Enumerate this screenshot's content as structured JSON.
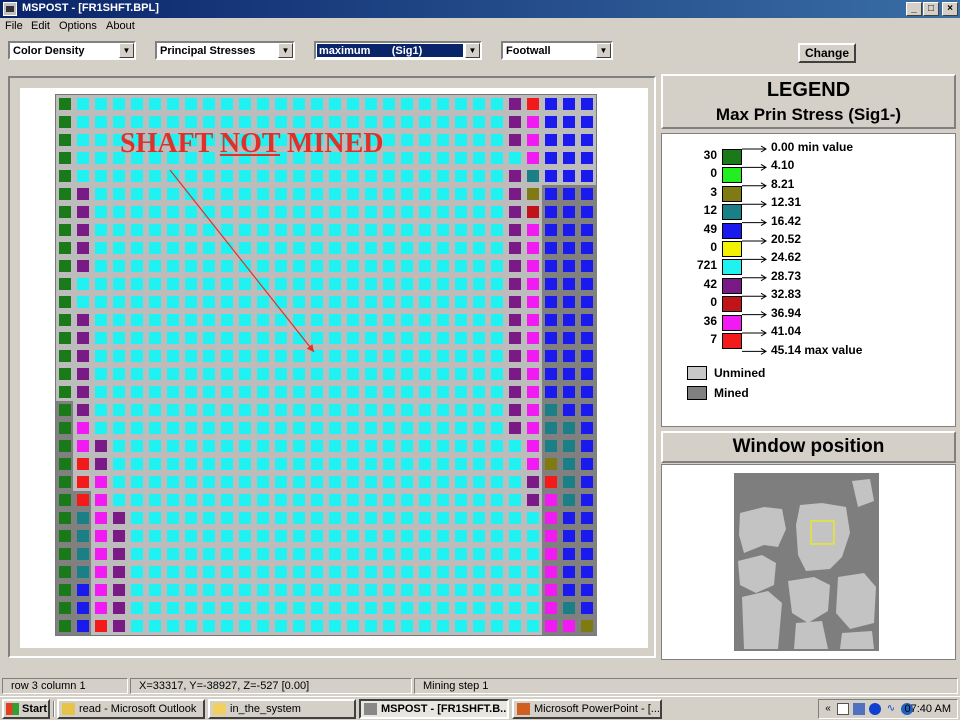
{
  "window": {
    "title": "MSPOST - [FR1SHFT.BPL]"
  },
  "menu": [
    "File",
    "Edit",
    "Options",
    "About"
  ],
  "toolbar": {
    "combos": [
      "Color Density",
      "Principal Stresses",
      "maximum       (Sig1)",
      "Footwall"
    ],
    "change_label": "Change"
  },
  "annotation": {
    "pre": "SHAFT ",
    "underlined": "NOT",
    "post": " MINED"
  },
  "legend": {
    "title": "LEGEND",
    "subtitle": "Max Prin Stress (Sig1-)",
    "rows": [
      {
        "count": "30",
        "color": "#1a7a1a",
        "value": "0.00 min value"
      },
      {
        "count": "0",
        "color": "#22ee22",
        "value": "4.10"
      },
      {
        "count": "3",
        "color": "#7f7a12",
        "value": "8.21"
      },
      {
        "count": "12",
        "color": "#1a7f86",
        "value": "12.31"
      },
      {
        "count": "49",
        "color": "#1a1aee",
        "value": "16.42"
      },
      {
        "count": "0",
        "color": "#f2f200",
        "value": "20.52"
      },
      {
        "count": "721",
        "color": "#20f2f2",
        "value": "24.62"
      },
      {
        "count": "42",
        "color": "#7a1a86",
        "value": "28.73"
      },
      {
        "count": "0",
        "color": "#c0141a",
        "value": "32.83"
      },
      {
        "count": "36",
        "color": "#f21af2",
        "value": "36.94"
      },
      {
        "count": "7",
        "color": "#f21a1a",
        "value": "41.04"
      }
    ],
    "max_label": "45.14 max value",
    "keys": [
      {
        "label": "Unmined",
        "color": "#c8c8c8"
      },
      {
        "label": "Mined",
        "color": "#808080"
      }
    ]
  },
  "window_position": {
    "title": "Window position"
  },
  "status": [
    "row 3    column 1",
    "X=33317, Y=-38927, Z=-527   [0.00]",
    "Mining step 1"
  ],
  "taskbar": {
    "start": "Start",
    "tasks": [
      "read - Microsoft Outlook",
      "in_the_system",
      "MSPOST - [FR1SHFT.B...",
      "Microsoft PowerPoint - [..."
    ],
    "clock": "07:40 AM"
  },
  "grid_colors": {
    "G": "#1a7a1a",
    "O": "#7f7a12",
    "T": "#1a7f86",
    "B": "#1a1aee",
    "C": "#20f2f2",
    "P": "#7a1a86",
    "R": "#f21a1a",
    "M": "#f21af2",
    "D": "#c0141a"
  },
  "grid_rows": [
    "GCCCCCCCCCCCCCCCCCCCCCCCCPRBBB",
    "GCCCCCCCCCCCCCCCCCCCCCCCCPMBBB",
    "GCCCCCCCCCCCCCCCCCCCCCCCCPMBBB",
    "GCCCCCCCCCCCCCCCCCCCCCCCCCMBBB",
    "GCCCCCCCCCCCCCCCCCCCCCCCCPTBBB",
    "GPCCCCCCCCCCCCCCCCCCCCCCCPOBBB",
    "GPCCCCCCCCCCCCCCCCCCCCCCCPDBBB",
    "GPCCCCCCCCCCCCCCCCCCCCCCCPMBBB",
    "GPCCCCCCCCCCCCCCCCCCCCCCCPMBBB",
    "GPCCCCCCCCCCCCCCCCCCCCCCCPMBBB",
    "GCCCCCCCCCCCCCCCCCCCCCCCCPMBBB",
    "GCCCCCCCCCCCCCCCCCCCCCCCCPMBBB",
    "GPCCCCCCCCCCCCCCCCCCCCCCCPMBBB",
    "GPCCCCCCCCCCCCCCCCCCCCCCCPMBBB",
    "GPCCCCCCCCCCCCCCCCCCCCCCCPMBBB",
    "GPCCCCCCCCCCCCCCCCCCCCCCCPMBBB",
    "GPCCCCCCCCCCCCCCCCCCCCCCCPMBBB",
    "GPCCCCCCCCCCCCCCCCCCCCCCCPMTBB",
    "GMCCCCCCCCCCCCCCCCCCCCCCCPMTTB",
    "GMPCCCCCCCCCCCCCCCCCCCCCCCMTTB",
    "GRPCCCCCCCCCCCCCCCCCCCCCCCMOTB",
    "GRMCCCCCCCCCCCCCCCCCCCCCCCPRTB",
    "GRMCCCCCCCCCCCCCCCCCCCCCCCPMTB",
    "GTMPCCCCCCCCCCCCCCCCCCCCCCCMBB",
    "GTMPCCCCCCCCCCCCCCCCCCCCCCCMBB",
    "GTMPCCCCCCCCCCCCCCCCCCCCCCCMBB",
    "GTMPCCCCCCCCCCCCCCCCCCCCCCCMBB",
    "GBMPCCCCCCCCCCCCCCCCCCCCCCCMBB",
    "GBMPCCCCCCCCCCCCCCCCCCCCCCCMTB",
    "GBRPCCCCCCCCCCCCCCCCCCCCCCCMMO"
  ]
}
